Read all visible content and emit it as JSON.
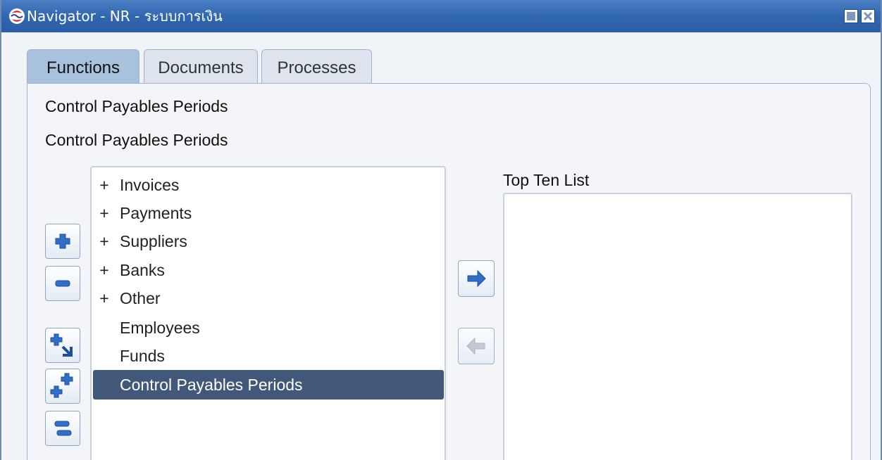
{
  "window": {
    "title": "Navigator - NR - ระบบการเงิน"
  },
  "tabs": [
    {
      "label": "Functions",
      "active": true
    },
    {
      "label": "Documents",
      "active": false
    },
    {
      "label": "Processes",
      "active": false
    }
  ],
  "main": {
    "description_line1": "Control Payables Periods",
    "description_line2": "Control Payables Periods",
    "tree": [
      {
        "label": "Invoices",
        "expander": "+"
      },
      {
        "label": "Payments",
        "expander": "+"
      },
      {
        "label": "Suppliers",
        "expander": "+"
      },
      {
        "label": "Banks",
        "expander": "+"
      },
      {
        "label": "Other",
        "expander": "+"
      },
      {
        "label": "Employees",
        "expander": ""
      },
      {
        "label": "Funds",
        "expander": ""
      },
      {
        "label": "Control Payables Periods",
        "expander": "",
        "selected": true
      }
    ],
    "top_ten_label": "Top Ten List",
    "top_ten_items": []
  },
  "icons": {
    "app_logo": "oracle-logo-icon",
    "expand": "plus-icon",
    "collapse": "minus-icon",
    "expand_branch": "expand-branch-icon",
    "expand_all": "expand-all-icon",
    "collapse_all": "collapse-all-icon",
    "add_to_top_ten": "arrow-right-icon",
    "remove_from_top_ten": "arrow-left-icon"
  },
  "colors": {
    "titlebar": "#3167b0",
    "active_tab": "#a8c2de",
    "selection": "#42587a",
    "icon_blue": "#2f6fc8"
  }
}
